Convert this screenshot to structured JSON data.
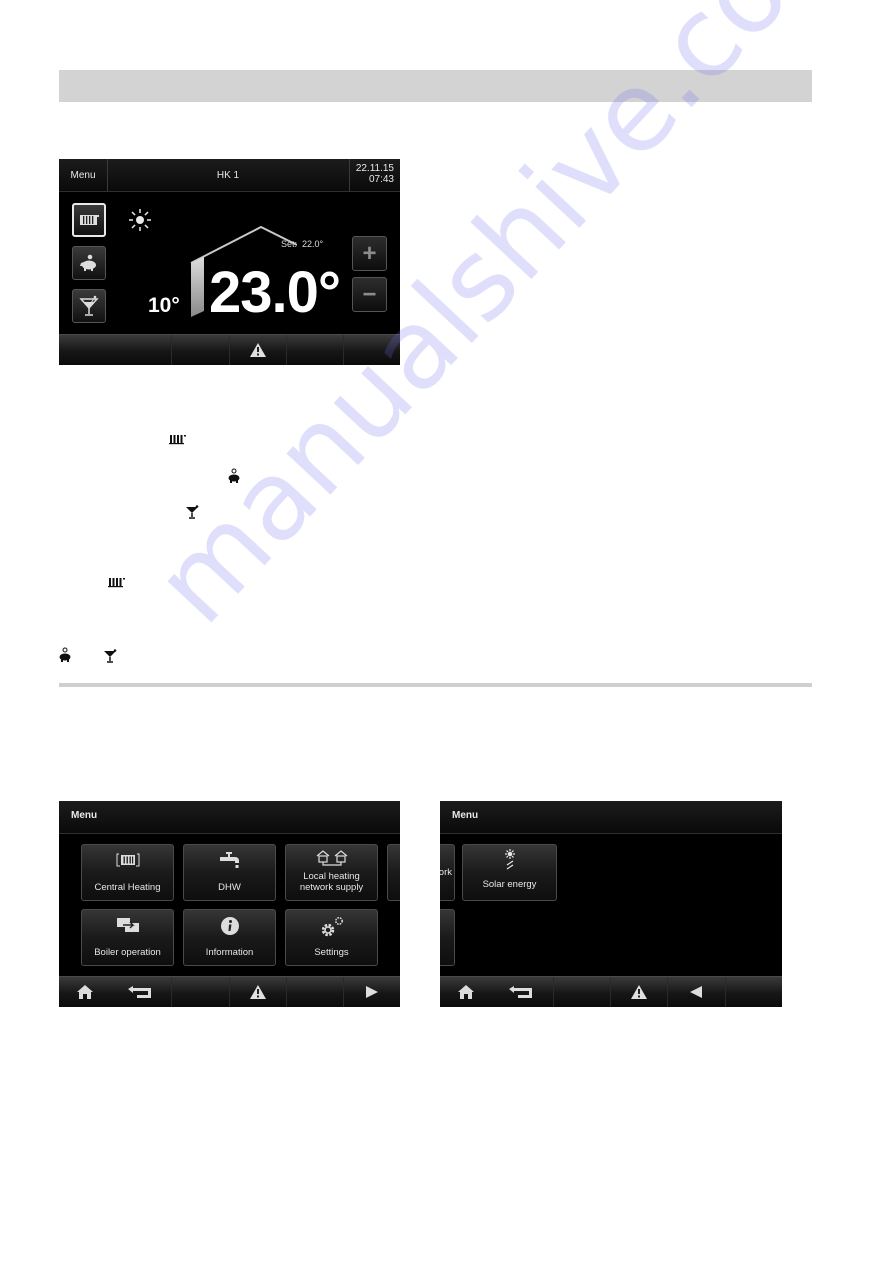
{
  "screen_hk": {
    "header": {
      "menu_label": "Menu",
      "title": "HK 1",
      "date": "22.11.15",
      "time": "07:43"
    },
    "mode_buttons": [
      {
        "icon": "radiator-icon",
        "active": true
      },
      {
        "icon": "piggy-bank-icon",
        "active": false
      },
      {
        "icon": "cocktail-icon",
        "active": false
      }
    ],
    "weather_icon": "sun-icon",
    "outside_temp": "10°",
    "room_temp": "23.0°",
    "set_label": "Set:",
    "set_value": "22.0°",
    "plus_label": "+",
    "minus_label": "−",
    "footer_icon": "warning-icon"
  },
  "inline_icons": [
    "radiator-icon",
    "piggy-bank-icon",
    "cocktail-icon",
    "radiator-icon",
    "piggy-bank-icon",
    "cocktail-icon"
  ],
  "menu_screen_1": {
    "title": "Menu",
    "tiles": [
      {
        "label": "Central Heating",
        "icon": "central-heating-icon"
      },
      {
        "label": "DHW",
        "icon": "tap-icon"
      },
      {
        "label": "Local heating network supply",
        "icon": "heating-network-icon"
      },
      {
        "label": "Boiler operation",
        "icon": "boiler-switch-icon"
      },
      {
        "label": "Information",
        "icon": "info-icon"
      },
      {
        "label": "Settings",
        "icon": "gears-icon"
      }
    ],
    "footer": [
      "home-icon",
      "back-icon",
      "warning-icon",
      "arrow-right-icon"
    ]
  },
  "menu_screen_2": {
    "title": "Menu",
    "partial_tile_label": "ork",
    "tiles": [
      {
        "label": "Solar energy",
        "icon": "solar-icon"
      }
    ],
    "footer": [
      "home-icon",
      "back-icon",
      "warning-icon",
      "arrow-left-icon"
    ]
  },
  "watermark": "manualshive.com"
}
